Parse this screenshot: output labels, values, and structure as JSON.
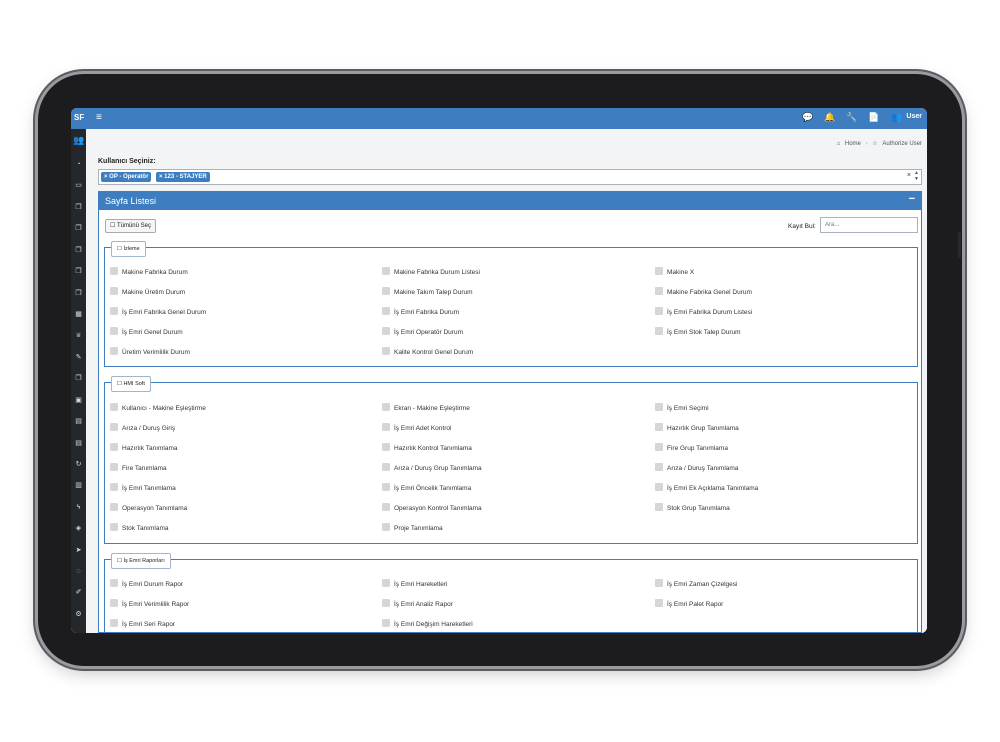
{
  "topbar": {
    "brand": "SF",
    "user_label": "User"
  },
  "breadcrumb": {
    "home": "Home",
    "current": "Authorize User"
  },
  "select": {
    "label": "Kullanıcı Seçiniz:",
    "tags": [
      "OP - Operatör",
      "123 - STAJYER"
    ]
  },
  "panel": {
    "title": "Sayfa Listesi",
    "select_all_label": "☐ Tümünü Seç",
    "find_label": "Kayıt Bul:",
    "find_placeholder": "Ara..."
  },
  "groups": [
    {
      "legend": "☐ İzleme",
      "items": [
        "Makine Fabrika Durum",
        "Makine Fabrika Durum Listesi",
        "Makine X",
        "Makine Üretim Durum",
        "Makine Takım Talep Durum",
        "Makine Fabrika Genel Durum",
        "İş Emri Fabrika Genel Durum",
        "İş Emri Fabrika Durum",
        "İş Emri Fabrika Durum Listesi",
        "İş Emri Genel Durum",
        "İş Emri Operatör Durum",
        "İş Emri Stok Talep Durum",
        "Üretim Verimlilik Durum",
        "Kalite Kontrol Genel Durum"
      ]
    },
    {
      "legend": "☐ HMI Soft",
      "items": [
        "Kullanıcı - Makine Eşleştirme",
        "Ekran - Makine Eşleştirme",
        "İş Emri Seçimi",
        "Arıza / Duruş Giriş",
        "İş Emri Adet Kontrol",
        "Hazırlık Grup Tanımlama",
        "Hazırlık Tanımlama",
        "Hazırlık Kontrol Tanımlama",
        "Fire Grup Tanımlama",
        "Fire Tanımlama",
        "Arıza / Duruş Grup Tanımlama",
        "Arıza / Duruş Tanımlama",
        "İş Emri Tanımlama",
        "İş Emri Öncelik Tanımlama",
        "İş Emri Ek Açıklama Tanımlama",
        "Operasyon Tanımlama",
        "Operasyon Kontrol Tanımlama",
        "Stok Grup Tanımlama",
        "Stok Tanımlama",
        "Proje Tanımlama"
      ]
    },
    {
      "legend": "☐ İş Emri Raporları",
      "items": [
        "İş Emri Durum Rapor",
        "İş Emri Hareketleri",
        "İş Emri Zaman Çizelgesi",
        "İş Emri Verimlilik Rapor",
        "İş Emri Analiz Rapor",
        "İş Emri Palet Rapor",
        "İş Emri Seri Rapor",
        "İş Emri Değişim Hareketleri"
      ]
    }
  ],
  "icons": {
    "sidebar": [
      "users-icon",
      "dashboard-icon",
      "monitor-icon",
      "copy-icon",
      "copy-icon",
      "copy-icon",
      "copy-icon",
      "copy-icon",
      "calendar-icon",
      "filter-icon",
      "wrench-icon",
      "copy-icon",
      "calendar-check-icon",
      "table-icon",
      "table-icon",
      "refresh-icon",
      "book-icon",
      "bolt-icon",
      "cube-icon",
      "send-icon",
      "chat-icon",
      "pencil-icon",
      "gear-icon"
    ],
    "topbar": [
      "chat-icon",
      "bell-icon",
      "wrench-icon",
      "file-icon",
      "users-icon"
    ]
  }
}
